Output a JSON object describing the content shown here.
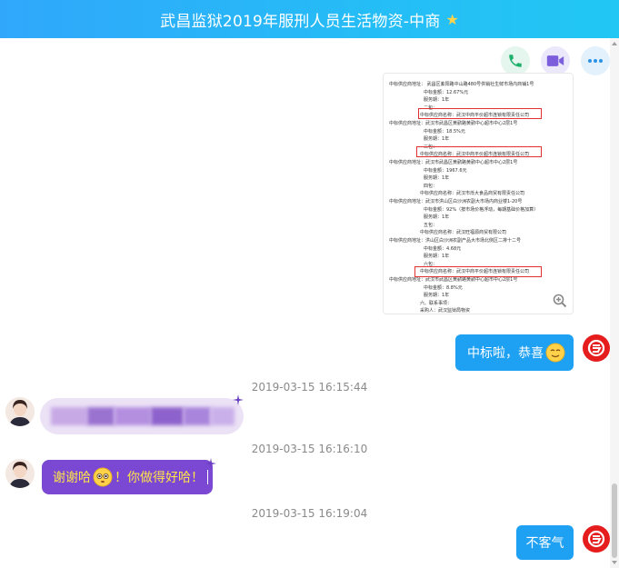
{
  "header": {
    "title": "武昌监狱2019年服刑人员生活物资-中商",
    "star_icon": "star-icon"
  },
  "toolbar": {
    "icons": [
      "phone-icon",
      "video-icon",
      "more-icon"
    ]
  },
  "document_image": {
    "lines": [
      "中标供应商地址：  武昌区紫阳路中山路480号供销社生鲜市场内商铺1号",
      "中标金额：12.67%元",
      "服务期：1年",
      "二包：",
      "中标供应商名称：武汉中商平价超市连锁有限责任公司",
      "中标供应商地址：武汉市武昌区黄鹂路黄鹂中心超市中心2层1号",
      "中标金额：18.5%元",
      "服务期：1年",
      "三包：",
      "中标供应商名称：武汉中商平价超市连锁有限责任公司",
      "中标供应商地址：武汉市武昌区黄鹂路黄鹂中心超市中心2层1号",
      "中标金额：1967.6元",
      "服务期：1年",
      "四包：",
      "中标供应商名称：武汉市烁大食品商贸有限责任公司",
      "中标供应商地址：武汉市洪山区白沙洲农副大市场内商业楼1-20号",
      "中标金额：92%（按市场价格浮动，每期基础价格加算）",
      "服务期：1年",
      "五包：",
      "中标供应商名称：武汉旺福源商贸有限公司",
      "中标供应商地址：洪山区白沙洲农副产品大市场北侧区二排十二号",
      "中标金额：4.68元",
      "服务期：1年",
      "六包：",
      "中标供应商名称：武汉中商平价超市连锁有限责任公司",
      "中标供应商地址：武汉市武昌区黄鹂路黄鹂中心超市中心2层1号",
      "中标金额：8.8%元",
      "服务期：1年",
      "六、联系事项：",
      "采购人：武汉监狱局物资"
    ],
    "zoom_icon": "zoom-in-icon"
  },
  "messages": {
    "msg1": {
      "text": "中标啦，恭喜"
    },
    "time1": "2019-03-15 16:15:44",
    "time2": "2019-03-15 16:16:10",
    "msg3": {
      "before": "谢谢哈",
      "after": "！你做得好哈！"
    },
    "time3": "2019-03-15 16:19:04",
    "msg4": {
      "text": "不客气"
    }
  },
  "colors": {
    "header_gradient_start": "#30a7fb",
    "header_gradient_end": "#22c7f4",
    "right_bubble": "#1ea0f3",
    "purple_bubble": "#7a48d2",
    "purple_bubble_text": "#ffe34a",
    "avatar_red": "#e51d1d"
  }
}
